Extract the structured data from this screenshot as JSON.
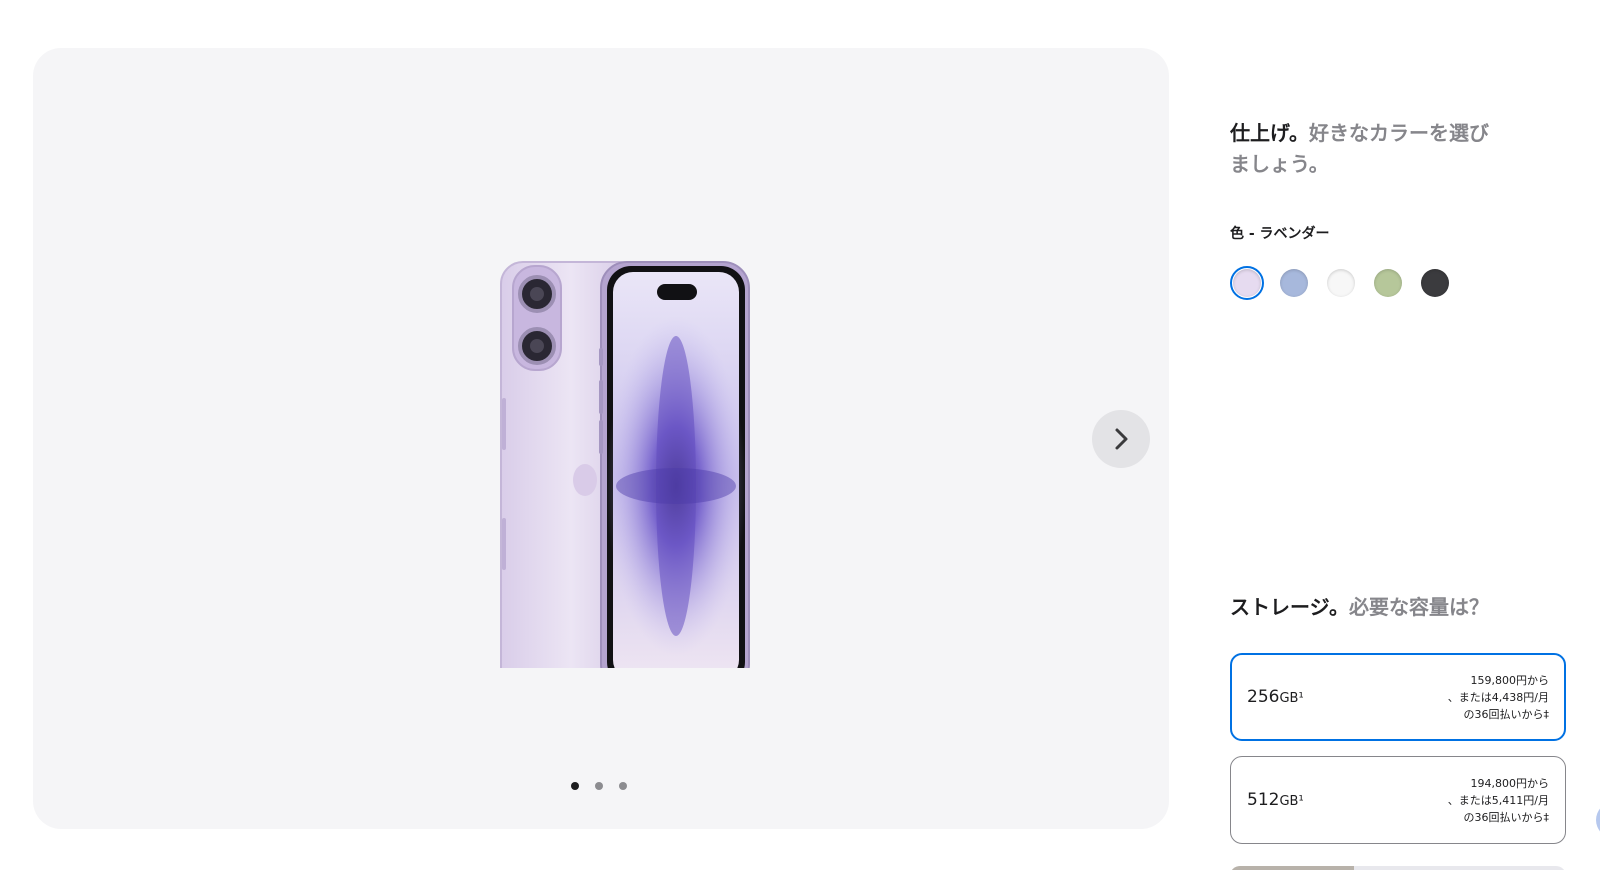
{
  "gallery": {
    "image_alt": "iPhone ラベンダー",
    "active_dot": 0,
    "dots": [
      {
        "label": "1"
      },
      {
        "label": "2"
      },
      {
        "label": "3"
      }
    ]
  },
  "finish": {
    "heading_strong": "仕上げ。",
    "heading_muted": "好きなカラーを選びましょう。",
    "color_label": "色 - ラベンダー",
    "swatches": [
      {
        "name": "ラベンダー",
        "color": "#e6dbf0",
        "selected": true
      },
      {
        "name": "ブルー",
        "color": "#a7b8dc",
        "selected": false
      },
      {
        "name": "ホワイト",
        "color": "#f7f7f7",
        "selected": false
      },
      {
        "name": "グリーン",
        "color": "#b6c79a",
        "selected": false
      },
      {
        "name": "ブラック",
        "color": "#3b3b3e",
        "selected": false
      }
    ]
  },
  "storage": {
    "heading_strong": "ストレージ。",
    "heading_muted": "必要な容量は？",
    "options": [
      {
        "capacity": "256",
        "unit": "GB¹",
        "price_line1": "159,800円から",
        "price_line2": "、または4,438円/月",
        "price_line3": "の36回払いから‡",
        "selected": true
      },
      {
        "capacity": "512",
        "unit": "GB¹",
        "price_line1": "194,800円から",
        "price_line2": "、または5,411円/月",
        "price_line3": "の36回払いから‡",
        "selected": false
      }
    ]
  },
  "colors": {
    "accent": "#0071e3",
    "gallery_bg": "#f5f5f7",
    "muted_text": "#86868b"
  }
}
